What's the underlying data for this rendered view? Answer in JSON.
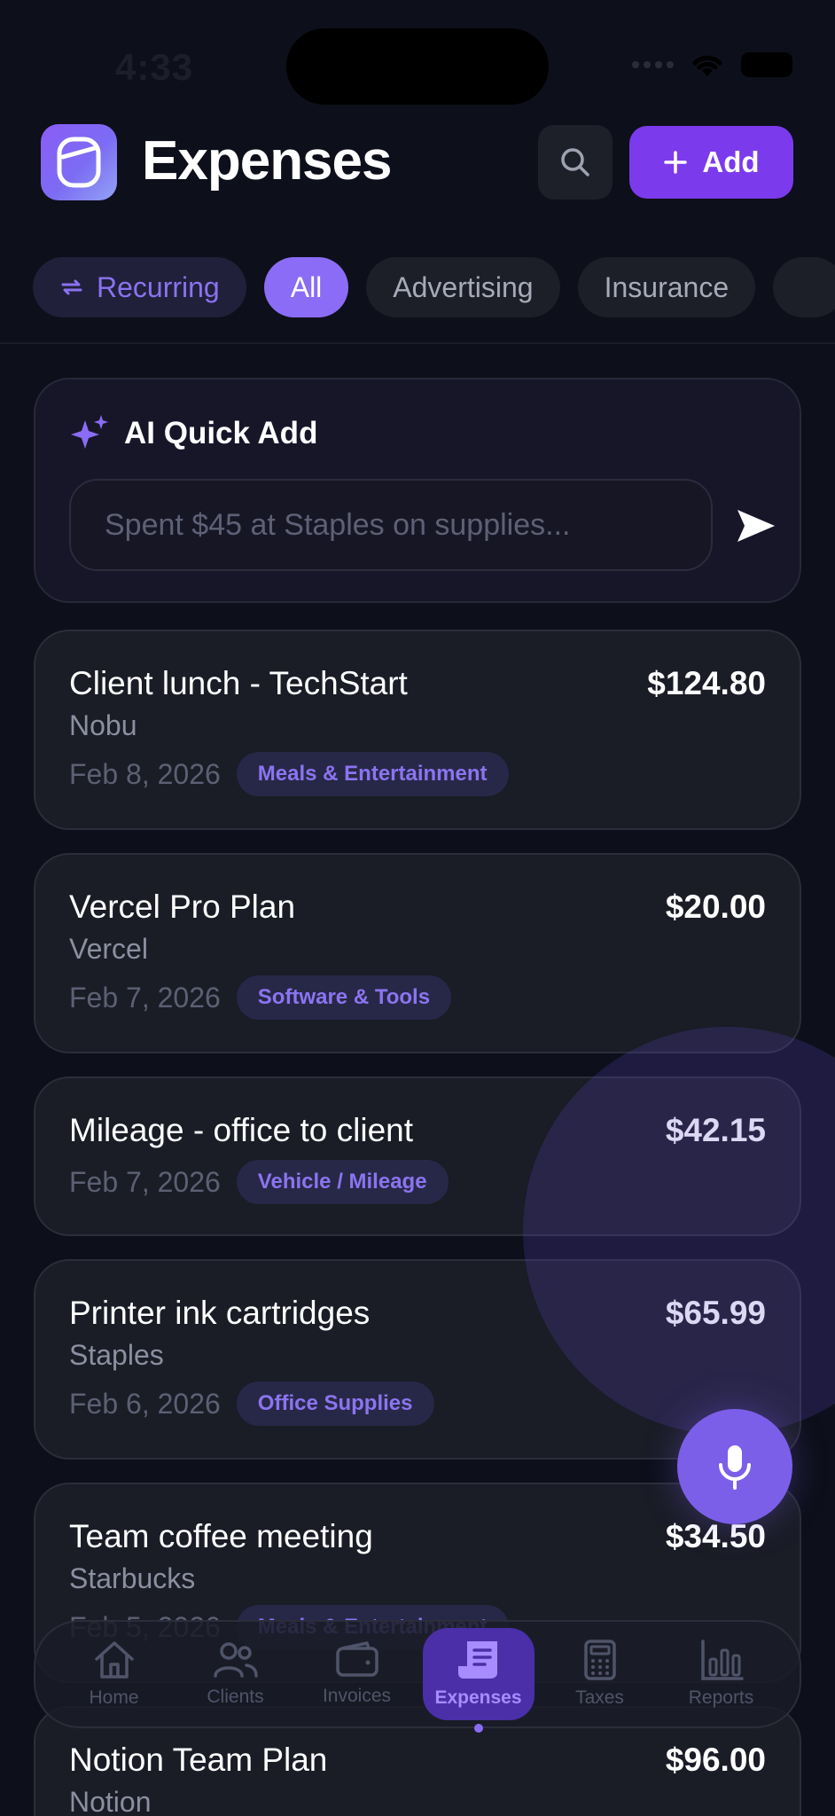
{
  "status_bar": {
    "time": "4:33"
  },
  "header": {
    "title": "Expenses",
    "add_label": "Add"
  },
  "filters": [
    {
      "label": "Recurring",
      "type": "recurring"
    },
    {
      "label": "All",
      "type": "active"
    },
    {
      "label": "Advertising",
      "type": "normal"
    },
    {
      "label": "Insurance",
      "type": "normal"
    }
  ],
  "ai_quick_add": {
    "title": "AI Quick Add",
    "placeholder": "Spent $45 at Staples on supplies..."
  },
  "expenses": [
    {
      "title": "Client lunch - TechStart",
      "vendor": "Nobu",
      "date": "Feb 8, 2026",
      "category": "Meals & Entertainment",
      "amount": "$124.80"
    },
    {
      "title": "Vercel Pro Plan",
      "vendor": "Vercel",
      "date": "Feb 7, 2026",
      "category": "Software & Tools",
      "amount": "$20.00"
    },
    {
      "title": "Mileage - office to client",
      "vendor": "",
      "date": "Feb 7, 2026",
      "category": "Vehicle / Mileage",
      "amount": "$42.15"
    },
    {
      "title": "Printer ink cartridges",
      "vendor": "Staples",
      "date": "Feb 6, 2026",
      "category": "Office Supplies",
      "amount": "$65.99"
    },
    {
      "title": "Team coffee meeting",
      "vendor": "Starbucks",
      "date": "Feb 5, 2026",
      "category": "Meals & Entertainment",
      "amount": "$34.50"
    },
    {
      "title": "Notion Team Plan",
      "vendor": "Notion",
      "date": "",
      "category": "",
      "amount": "$96.00"
    }
  ],
  "nav": [
    {
      "label": "Home",
      "icon": "home-icon"
    },
    {
      "label": "Clients",
      "icon": "users-icon"
    },
    {
      "label": "Invoices",
      "icon": "wallet-icon"
    },
    {
      "label": "Expenses",
      "icon": "receipt-icon",
      "active": true
    },
    {
      "label": "Taxes",
      "icon": "calculator-icon"
    },
    {
      "label": "Reports",
      "icon": "bar-chart-icon"
    }
  ],
  "colors": {
    "accent": "#7c3aed",
    "chip_active": "#8b6cf6",
    "background": "#0d0f1a",
    "badge_text": "#8b74f0"
  }
}
